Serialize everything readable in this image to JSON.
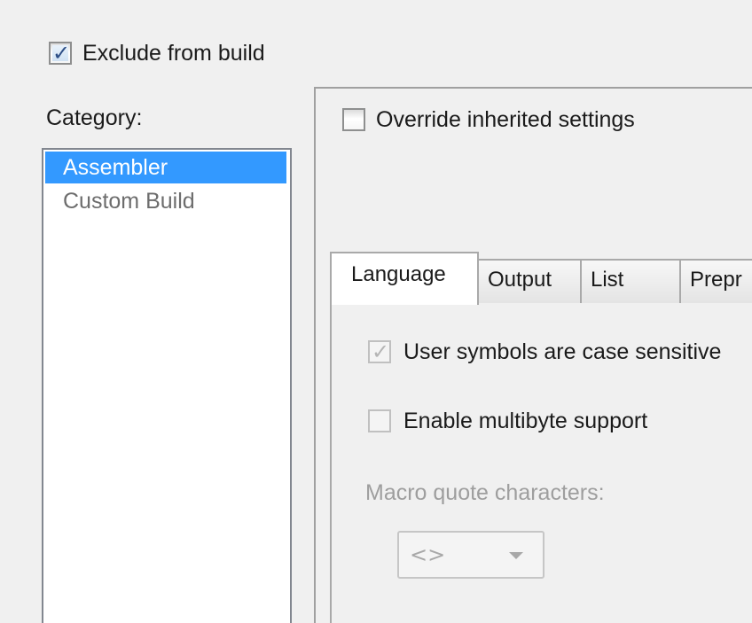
{
  "exclude_from_build": {
    "label": "Exclude from build",
    "checked": true
  },
  "category": {
    "label": "Category:",
    "items": [
      {
        "label": "Assembler",
        "selected": true
      },
      {
        "label": "Custom Build",
        "selected": false
      }
    ]
  },
  "override": {
    "label": "Override inherited settings",
    "checked": false
  },
  "tabs": [
    {
      "label": "Language",
      "active": true
    },
    {
      "label": "Output",
      "active": false
    },
    {
      "label": "List",
      "active": false
    },
    {
      "label": "Prepr",
      "active": false
    }
  ],
  "language": {
    "case_sensitive": {
      "label": "User symbols are case sensitive",
      "checked": true
    },
    "multibyte": {
      "label": "Enable multibyte support",
      "checked": false
    },
    "macro_quote_label": "Macro quote characters:",
    "macro_quote_value": "<>"
  },
  "colors": {
    "selection": "#3399ff",
    "window_bg": "#f0f0f0"
  }
}
